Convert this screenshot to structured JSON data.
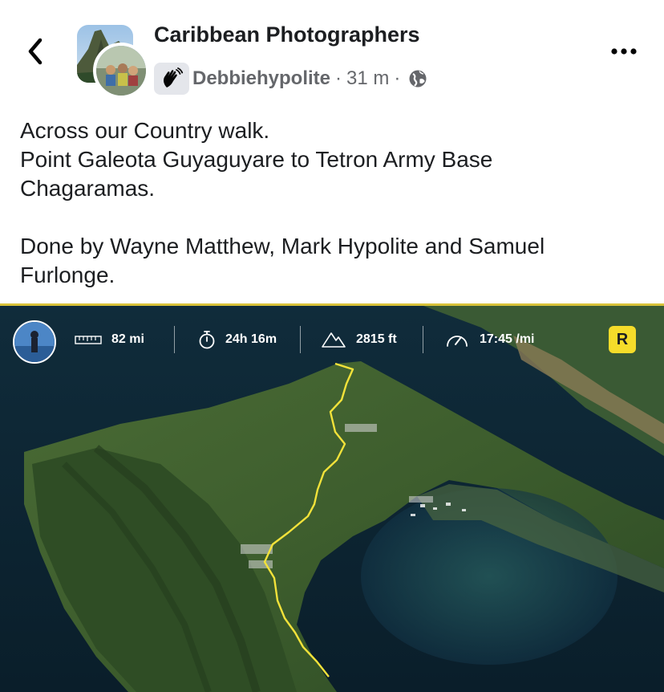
{
  "header": {
    "group_name": "Caribbean Photographers",
    "author": "Debbiehypolite",
    "separator": "·",
    "time": "31 m",
    "back_icon": "chevron-left-icon",
    "more_icon": "ellipsis-icon",
    "privacy_icon": "globe-icon",
    "badge_icon": "waving-hand-icon"
  },
  "post": {
    "lines": [
      "Across our Country walk.",
      "Point Galeota Guyaguyare to Tetron Army Base",
      "Chagaramas.",
      "",
      "Done by Wayne Matthew, Mark Hypolite and Samuel",
      "Furlonge."
    ]
  },
  "media": {
    "stats": {
      "distance": "82 mi",
      "duration": "24h 16m",
      "elevation": "2815 ft",
      "pace": "17:45 /mi"
    },
    "logo": "R",
    "colors": {
      "route": "#f2e23a",
      "accent_line": "#d8c23a",
      "logo_bg": "#f5dc2a",
      "link_blue": "#3b6fd6"
    }
  }
}
